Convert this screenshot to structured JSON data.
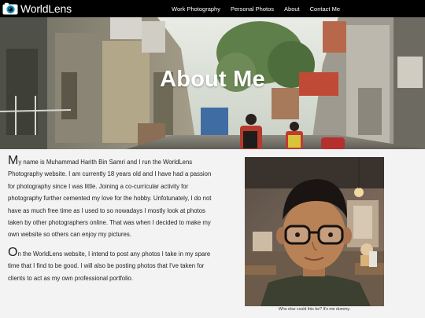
{
  "navbar": {
    "brand": "WorldLens",
    "links": [
      "Work Photography",
      "Personal Photos",
      "About",
      "Contact Me"
    ]
  },
  "hero": {
    "title": "About Me"
  },
  "about": {
    "p1_cap": "M",
    "p1_rest": "y name is Muhammad Harith Bin Samri and I run the WorldLens Photography website. I am currently 18 years old and I have had a passion for photography since I was little. Joining a co-curricular activity for photography further cemented my love for the hobby. Unfotunately, I do not have as much free time as I used to so nowadays I mostly look at photos taken by other photographers online. That was when I decided to make my own website so others can enjoy my pictures.",
    "p2_cap": "O",
    "p2_rest": "n the WorldLens website, I intend to post any photos I take in my spare time that I find to be good. I will also be posting photos that I've taken for clients to act as my own professional portfolio."
  },
  "photo": {
    "caption": "Who else could this be? It's me dummy."
  }
}
